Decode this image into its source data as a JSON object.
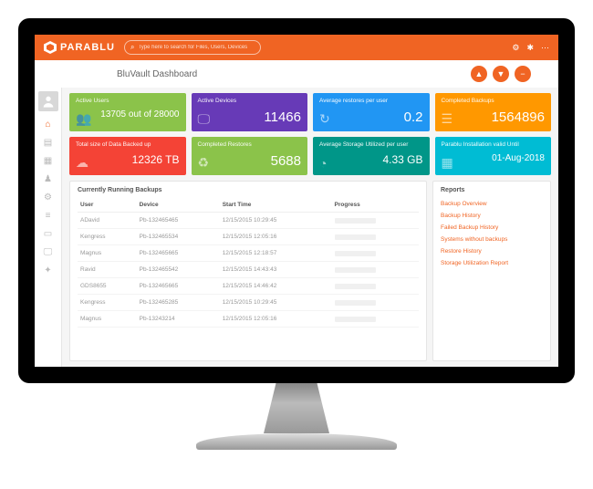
{
  "brand": "PARABLU",
  "search": {
    "placeholder": "Type here to search for Files, Users, Devices"
  },
  "page_title": "BluVault Dashboard",
  "cards": [
    {
      "title": "Active Users",
      "value": "13705 out of 28000",
      "color": "c-green",
      "icon": "users"
    },
    {
      "title": "Active Devices",
      "value": "11466",
      "color": "c-purple",
      "icon": "monitor"
    },
    {
      "title": "Average restores per user",
      "value": "0.2",
      "color": "c-blue",
      "icon": "restore"
    },
    {
      "title": "Completed Backups",
      "value": "1564896",
      "color": "c-orange",
      "icon": "disk"
    },
    {
      "title": "Total size of Data Backed up",
      "value": "12326 TB",
      "color": "c-red",
      "icon": "cloud"
    },
    {
      "title": "Completed Restores",
      "value": "5688",
      "color": "c-green",
      "icon": "recycle"
    },
    {
      "title": "Average Storage Utilized per user",
      "value": "4.33 GB",
      "color": "c-teal",
      "icon": "gauge"
    },
    {
      "title": "Parablu Installation valid Until",
      "value": "01-Aug-2018",
      "color": "c-cyan",
      "icon": "cal"
    }
  ],
  "table": {
    "title": "Currently Running Backups",
    "cols": [
      "User",
      "Device",
      "Start Time",
      "Progress"
    ],
    "rows": [
      {
        "user": "ADavid",
        "device": "Pb-132465465",
        "time": "12/15/2015 10:29:45"
      },
      {
        "user": "Kengress",
        "device": "Pb-132465534",
        "time": "12/15/2015 12:05:16"
      },
      {
        "user": "Magnus",
        "device": "Pb-132465665",
        "time": "12/15/2015 12:18:57"
      },
      {
        "user": "Ravid",
        "device": "Pb-132465542",
        "time": "12/15/2015 14:43:43"
      },
      {
        "user": "GDS8655",
        "device": "Pb-132465665",
        "time": "12/15/2015 14:46:42"
      },
      {
        "user": "Kengress",
        "device": "Pb-132465285",
        "time": "12/15/2015 10:29:45"
      },
      {
        "user": "Magnus",
        "device": "Pb-13243214",
        "time": "12/15/2015 12:05:16"
      }
    ]
  },
  "reports": {
    "title": "Reports",
    "links": [
      "Backup Overview",
      "Backup History",
      "Failed Backup History",
      "Systems without backups",
      "Restore History",
      "Storage Utilization Report"
    ]
  }
}
